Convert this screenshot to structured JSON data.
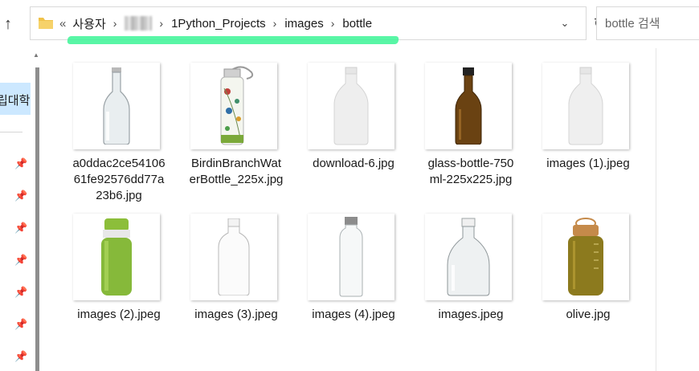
{
  "address": {
    "overflow_glyph": "«",
    "crumbs": [
      "사용자",
      "",
      "1Python_Projects",
      "images",
      "bottle"
    ],
    "separator": "›"
  },
  "search": {
    "placeholder": "bottle 검색"
  },
  "nav": {
    "selected_label": "립대학"
  },
  "files": [
    {
      "name": "a0ddac2ce5410661fe92576dd77a23b6.jpg",
      "label_lines": [
        "a0ddac2ce54106",
        "61fe92576dd77a",
        "23b6.jpg"
      ],
      "icon": "clear-beer-bottle"
    },
    {
      "name": "BirdinBranchWaterBottle_225x.jpg",
      "label_lines": [
        "BirdinBranchWat",
        "erBottle_225x.jpg"
      ],
      "icon": "floral-water-bottle"
    },
    {
      "name": "download-6.jpg",
      "label_lines": [
        "download-6.jpg"
      ],
      "icon": "frosted-milk-bottle"
    },
    {
      "name": "glass-bottle-750ml-225x225.jpg",
      "label_lines": [
        "glass-bottle-750",
        "ml-225x225.jpg"
      ],
      "icon": "amber-swing-top-bottle"
    },
    {
      "name": "images (1).jpeg",
      "label_lines": [
        "images (1).jpeg"
      ],
      "icon": "frosted-milk-bottle"
    },
    {
      "name": "images (2).jpeg",
      "label_lines": [
        "images (2).jpeg"
      ],
      "icon": "green-sport-bottle"
    },
    {
      "name": "images (3).jpeg",
      "label_lines": [
        "images (3).jpeg"
      ],
      "icon": "clear-oval-bottle"
    },
    {
      "name": "images (4).jpeg",
      "label_lines": [
        "images (4).jpeg"
      ],
      "icon": "clear-glass-bottle-steel-cap"
    },
    {
      "name": "images.jpeg",
      "label_lines": [
        "images.jpeg"
      ],
      "icon": "clear-jug-bottle"
    },
    {
      "name": "olive.jpg",
      "label_lines": [
        "olive.jpg"
      ],
      "icon": "olive-wide-mouth-bottle"
    }
  ],
  "colors": {
    "selection": "#cce8ff",
    "highlight": "#3cf596",
    "folder": "#f0c24a"
  }
}
